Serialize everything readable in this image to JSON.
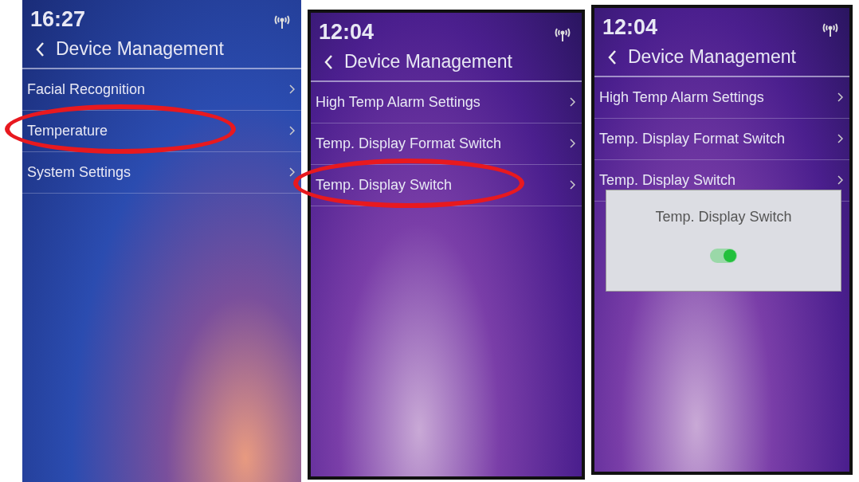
{
  "screens": [
    {
      "time": "16:27",
      "title": "Device Management",
      "items": [
        {
          "label": "Facial Recognition",
          "highlighted": false
        },
        {
          "label": "Temperature",
          "highlighted": true
        },
        {
          "label": "System Settings",
          "highlighted": false
        }
      ]
    },
    {
      "time": "12:04",
      "title": "Device Management",
      "items": [
        {
          "label": "High Temp Alarm Settings",
          "highlighted": false
        },
        {
          "label": "Temp. Display Format Switch",
          "highlighted": false
        },
        {
          "label": "Temp. Display Switch",
          "highlighted": true
        }
      ]
    },
    {
      "time": "12:04",
      "title": "Device Management",
      "items": [
        {
          "label": "High Temp Alarm Settings",
          "highlighted": false
        },
        {
          "label": "Temp. Display Format Switch",
          "highlighted": false
        },
        {
          "label": "Temp. Display Switch",
          "highlighted": false
        }
      ],
      "dialog": {
        "title": "Temp. Display Switch",
        "on": true
      }
    }
  ]
}
